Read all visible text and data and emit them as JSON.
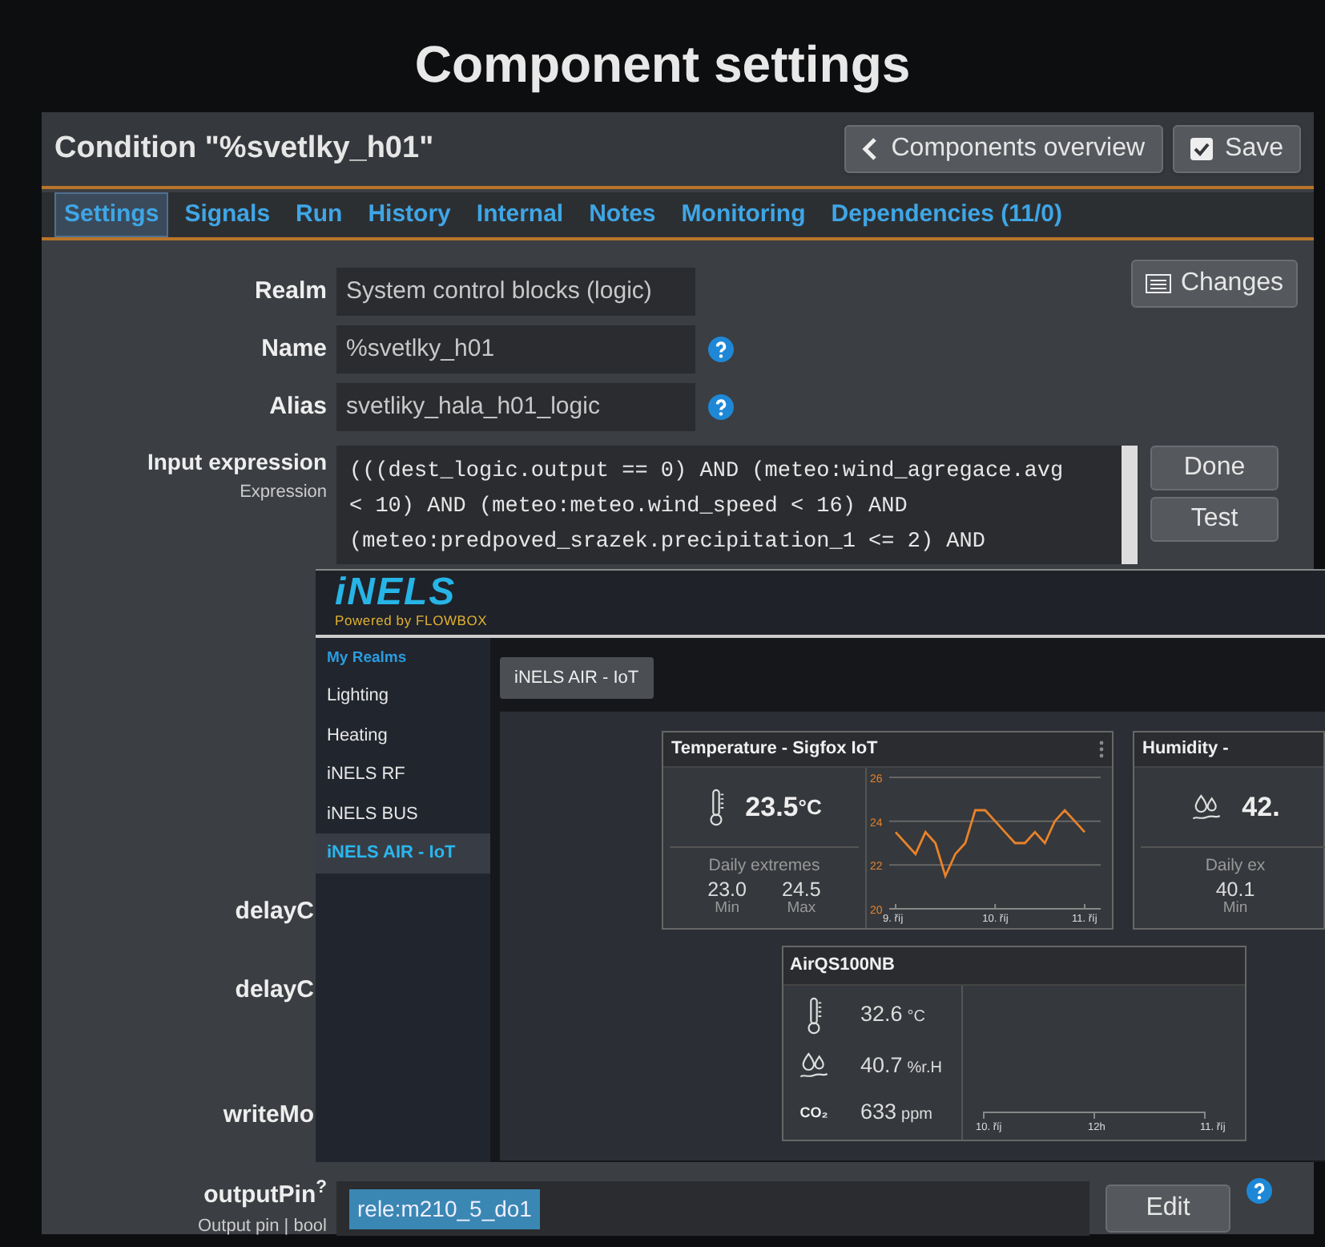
{
  "page_title": "Component settings",
  "settings": {
    "title": "Condition \"%svetlky_h01\"",
    "buttons": [
      {
        "label": "Components overview",
        "kind": "back"
      },
      {
        "label": "Save",
        "kind": "save"
      }
    ],
    "tabs": [
      {
        "label": "Settings",
        "selected": true
      },
      {
        "label": "Signals",
        "selected": false
      },
      {
        "label": "Run",
        "selected": false
      },
      {
        "label": "History",
        "selected": false
      },
      {
        "label": "Internal",
        "selected": false
      },
      {
        "label": "Notes",
        "selected": false
      },
      {
        "label": "Monitoring",
        "selected": false
      },
      {
        "label": "Dependencies (11/0)",
        "selected": false
      }
    ],
    "changes_button": "Changes",
    "fields": [
      {
        "label": "Realm",
        "value": "System control blocks (logic)",
        "help": false
      },
      {
        "label": "Name",
        "value": "%svetlky_h01",
        "help": true
      },
      {
        "label": "Alias",
        "value": "svetliky_hala_h01_logic",
        "help": true
      }
    ],
    "expression": {
      "label": "Input expression",
      "sublabel": "Expression",
      "lines": [
        "(((dest_logic.output == 0) AND (meteo:wind_agregace.avg",
        "< 10) AND (meteo:meteo.wind_speed < 16) AND",
        "(meteo:predpoved_srazek.precipitation_1 <= 2) AND"
      ],
      "buttons": [
        "Done",
        "Test"
      ]
    },
    "hidden_labels": [
      "delayC",
      "delayC",
      "writeMo"
    ],
    "output_pin": {
      "label": "outputPin",
      "mark": "?",
      "sublabel": "Output pin | bool",
      "value": "rele:m210_5_do1",
      "button": "Edit",
      "help": true
    }
  },
  "inels": {
    "logo": "iNELS",
    "tagline": "Powered by FLOWBOX",
    "sidebar": {
      "heading": "My Realms",
      "items": [
        {
          "label": "Lighting",
          "selected": false
        },
        {
          "label": "Heating",
          "selected": false
        },
        {
          "label": "iNELS RF",
          "selected": false
        },
        {
          "label": "iNELS BUS",
          "selected": false
        },
        {
          "label": "iNELS AIR - IoT",
          "selected": true
        }
      ]
    },
    "tab": "iNELS AIR - IoT",
    "cards": [
      {
        "kind": "temperature",
        "title": "Temperature - Sigfox IoT",
        "value": "23.5",
        "unit": "°C",
        "extremes_label": "Daily extremes",
        "min": {
          "value": "23.0",
          "label": "Min"
        },
        "max": {
          "value": "24.5",
          "label": "Max"
        },
        "chart_data": {
          "type": "line",
          "categories": [
            "9. říj",
            null,
            null,
            null,
            null,
            null,
            null,
            null,
            null,
            null,
            "10. říj",
            null,
            null,
            null,
            null,
            null,
            null,
            null,
            null,
            "11. říj"
          ],
          "values": [
            23.5,
            23,
            22.5,
            23.5,
            23,
            21.5,
            22.5,
            23,
            24.5,
            24.5,
            24,
            23.5,
            23,
            23,
            23.5,
            23,
            24,
            24.5,
            24,
            23.5
          ],
          "ylim": [
            20,
            26
          ],
          "yticks": [
            20,
            22,
            24,
            26
          ]
        }
      },
      {
        "kind": "humidity",
        "title": "Humidity -",
        "value": "42.",
        "extremes_label": "Daily ex",
        "min": {
          "value": "40.1",
          "label": "Min"
        }
      }
    ],
    "sensor_card": {
      "title": "AirQS100NB",
      "rows": [
        {
          "kind": "thermometer",
          "value": "32.6",
          "unit": "°C"
        },
        {
          "kind": "humidity",
          "value": "40.7",
          "unit": "%r.H"
        },
        {
          "kind": "text",
          "icon_text": "CO₂",
          "value": "633",
          "unit": "ppm"
        }
      ],
      "axis_labels": [
        "10. říj",
        "12h",
        "11. říj"
      ]
    }
  }
}
